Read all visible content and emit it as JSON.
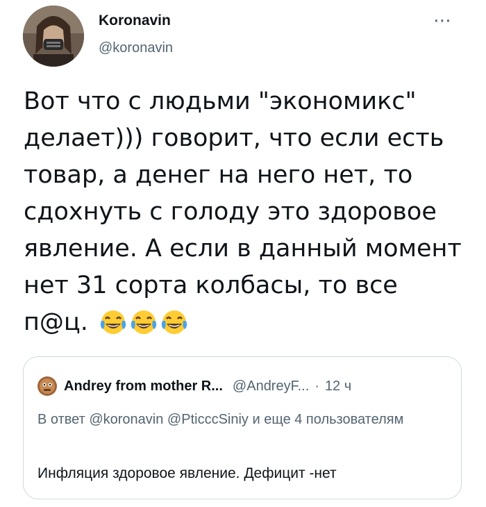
{
  "author": {
    "display_name": "Koronavin",
    "handle": "@koronavin"
  },
  "more_icon": "⋯",
  "tweet": {
    "text": "Вот что с людьми \"экономикс\" делает))) говорит, что если есть товар, а денег на него нет, то сдохнуть с голоду это здоровое явление. А если в данный момент нет 31 сорта колбасы, то все п@ц.",
    "emojis": [
      "face-with-tears-of-joy",
      "face-with-tears-of-joy",
      "face-with-tears-of-joy"
    ]
  },
  "quoted": {
    "display_name": "Andrey from mother R...",
    "handle": "@AndreyF...",
    "dot": "·",
    "time": "12 ч",
    "reply_prefix": "В ответ",
    "mention_1": "@koronavin",
    "mention_2": "@PticccSiniy",
    "reply_suffix": "и еще 4 пользователям",
    "text": "Инфляция здоровое явление. Дефицит -нет"
  }
}
